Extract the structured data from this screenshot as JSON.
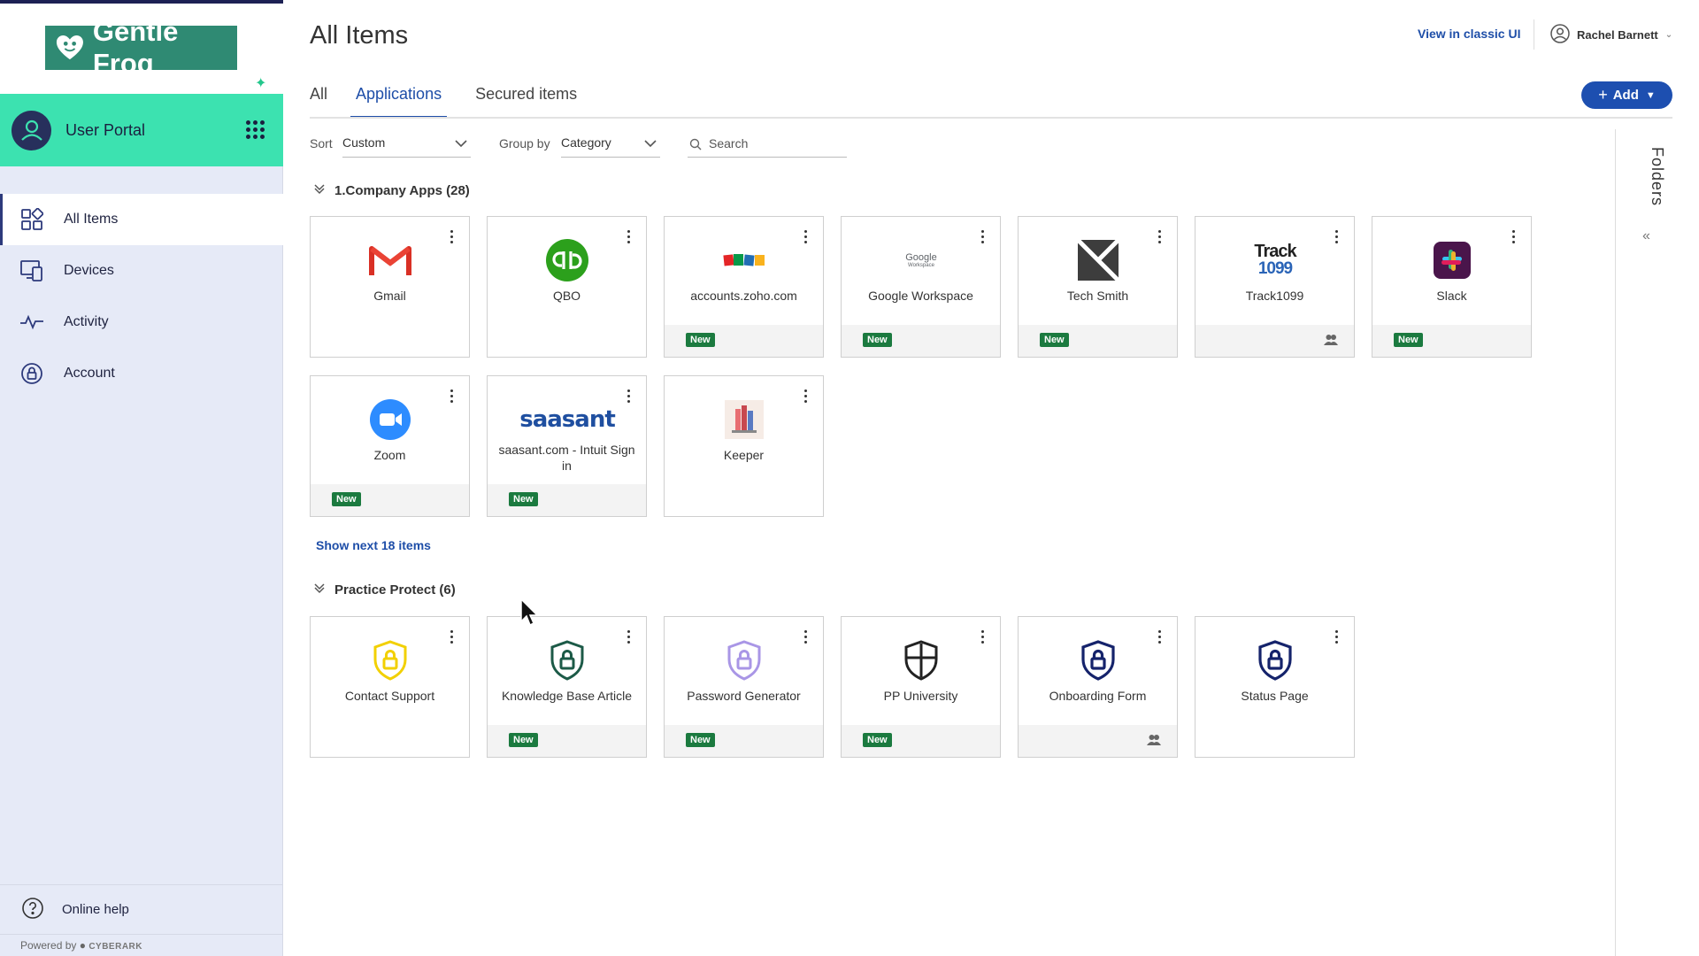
{
  "brand": {
    "name": "Gentle Frog"
  },
  "portal": {
    "title": "User Portal"
  },
  "nav": [
    {
      "label": "All Items"
    },
    {
      "label": "Devices"
    },
    {
      "label": "Activity"
    },
    {
      "label": "Account"
    }
  ],
  "help": {
    "label": "Online help"
  },
  "powered": {
    "prefix": "Powered by",
    "brand": "CYBERARK"
  },
  "header": {
    "title": "All Items",
    "classic_link": "View in classic UI",
    "user_name": "Rachel Barnett"
  },
  "tabs": [
    {
      "label": "All"
    },
    {
      "label": "Applications"
    },
    {
      "label": "Secured items"
    }
  ],
  "add_button": {
    "label": "Add"
  },
  "filters": {
    "sort_label": "Sort",
    "sort_value": "Custom",
    "group_label": "Group by",
    "group_value": "Category",
    "search_placeholder": "Search"
  },
  "folders": {
    "label": "Folders"
  },
  "sections": [
    {
      "title": "1.Company Apps (28)",
      "show_next": "Show next 18 items",
      "apps": [
        {
          "name": "Gmail",
          "badge": "",
          "icon": "gmail-icon"
        },
        {
          "name": "QBO",
          "badge": "",
          "icon": "quickbooks-icon"
        },
        {
          "name": "accounts.zoho.com",
          "badge": "New",
          "icon": "zoho-icon"
        },
        {
          "name": "Google Workspace",
          "badge": "New",
          "icon": "google-workspace-icon",
          "icon_text": "Google",
          "icon_subtext": "Workspace"
        },
        {
          "name": "Tech Smith",
          "badge": "New",
          "icon": "techsmith-icon"
        },
        {
          "name": "Track1099",
          "badge": "",
          "icon": "track1099-icon",
          "shared": true,
          "icon_text": "Track",
          "icon_subtext": "1099"
        },
        {
          "name": "Slack",
          "badge": "New",
          "icon": "slack-icon"
        },
        {
          "name": "Zoom",
          "badge": "New",
          "icon": "zoom-icon"
        },
        {
          "name": "saasant.com - Intuit Sign in",
          "badge": "New",
          "icon": "saasant-icon",
          "icon_text": "saasant"
        },
        {
          "name": "Keeper",
          "badge": "",
          "icon": "keeper-icon"
        }
      ]
    },
    {
      "title": "Practice Protect (6)",
      "apps": [
        {
          "name": "Contact Support",
          "badge": "",
          "icon": "shield-lock-yellow-icon"
        },
        {
          "name": "Knowledge Base Article",
          "badge": "New",
          "icon": "shield-lock-green-icon"
        },
        {
          "name": "Password Generator",
          "badge": "New",
          "icon": "shield-lock-purple-icon"
        },
        {
          "name": "PP University",
          "badge": "New",
          "icon": "shield-cross-icon"
        },
        {
          "name": "Onboarding Form",
          "badge": "",
          "icon": "shield-lock-navy-icon",
          "shared": true
        },
        {
          "name": "Status Page",
          "badge": "",
          "icon": "shield-lock-navy-icon"
        }
      ]
    }
  ],
  "colors": {
    "accent": "#1e4ea8",
    "portal_bar": "#3ce2b0",
    "sidebar_bg": "#e6eaf7",
    "badge_new": "#1b7a3f",
    "logo_bg": "#2f8a73"
  }
}
